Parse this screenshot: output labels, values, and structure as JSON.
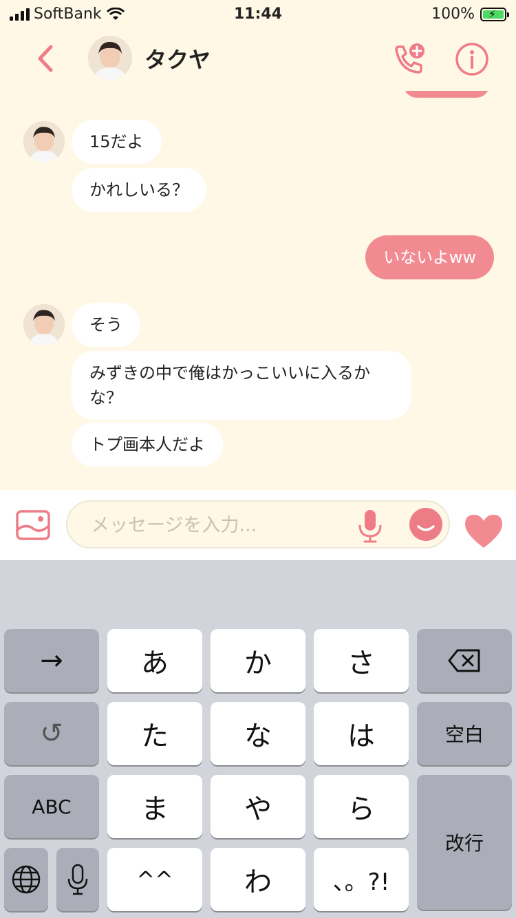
{
  "status_bar": {
    "carrier": "SoftBank",
    "time": "11:44",
    "battery": "100%"
  },
  "header": {
    "contact_name": "タクヤ",
    "back_icon": "chevron-left-icon",
    "call_icon": "phone-plus-icon",
    "info_icon": "info-icon"
  },
  "messages": [
    {
      "from": "them",
      "text": "15だよ"
    },
    {
      "from": "them",
      "text": "かれしいる？"
    },
    {
      "from": "me",
      "text": "いないよww"
    },
    {
      "from": "them",
      "text": "そう"
    },
    {
      "from": "them",
      "text": "みずきの中で俺はかっこいいに入るかな？"
    },
    {
      "from": "them",
      "text": "トプ画本人だよ"
    }
  ],
  "input": {
    "placeholder": "メッセージを入力..."
  },
  "keyboard": {
    "row1": [
      "→",
      "あ",
      "か",
      "さ",
      "⌫"
    ],
    "row2": [
      "↺",
      "た",
      "な",
      "は",
      "空白"
    ],
    "row3": [
      "ABC",
      "ま",
      "や",
      "ら"
    ],
    "row4": [
      "🌐",
      "🎤",
      "^^",
      "わ",
      "、。?!"
    ],
    "enter": "改行"
  },
  "colors": {
    "accent": "#f28b91",
    "background": "#fff8e6",
    "bubble_in": "#ffffff",
    "keyboard_bg": "#d2d4db",
    "key_dark": "#abaeb8"
  }
}
